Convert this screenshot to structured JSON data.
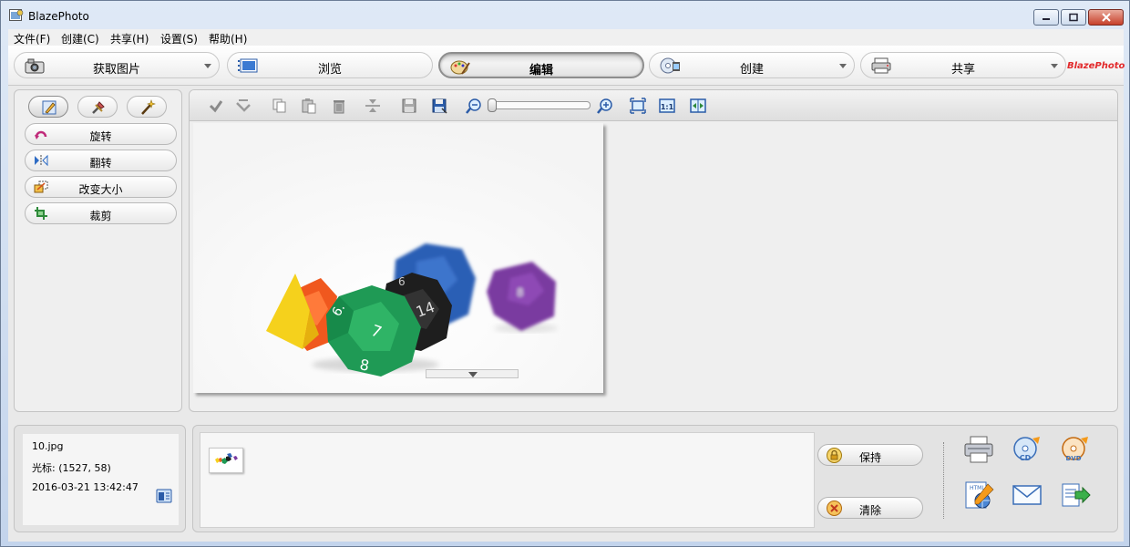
{
  "window": {
    "title": "BlazePhoto"
  },
  "menu": [
    "文件(F)",
    "创建(C)",
    "共享(H)",
    "设置(S)",
    "帮助(H)"
  ],
  "modebar": {
    "buttons": [
      {
        "label": "获取图片",
        "icon": "camera-icon",
        "dropdown": true
      },
      {
        "label": "浏览",
        "icon": "browse-icon",
        "dropdown": false
      },
      {
        "label": "编辑",
        "icon": "palette-icon",
        "dropdown": false,
        "active": true
      },
      {
        "label": "创建",
        "icon": "cd-film-icon",
        "dropdown": true
      },
      {
        "label": "共享",
        "icon": "printer-icon",
        "dropdown": true
      }
    ],
    "brand": "BlazePhoto"
  },
  "left_panel": {
    "tabs": [
      "pencil-icon",
      "tools-icon",
      "magic-wand-icon"
    ],
    "tools": [
      {
        "label": "旋转",
        "icon": "rotate-icon"
      },
      {
        "label": "翻转",
        "icon": "flip-icon"
      },
      {
        "label": "改变大小",
        "icon": "resize-icon"
      },
      {
        "label": "裁剪",
        "icon": "crop-icon"
      }
    ]
  },
  "edit_toolbar": {
    "tools": [
      "undo-icon",
      "redo-icon",
      "copy-icon",
      "paste-icon",
      "delete-icon",
      "split-icon",
      "save-icon",
      "save-as-icon",
      "zoom-out-icon",
      "zoom-in-icon",
      "fit-window-icon",
      "actual-size-icon",
      "fit-width-icon"
    ],
    "zoom_level": 0
  },
  "info": {
    "filename": "10.jpg",
    "cursor": "光标: (1527, 58)",
    "datetime": "2016-03-21 13:42:47"
  },
  "tray": {
    "keep_label": "保持",
    "clear_label": "清除",
    "share_icons": [
      "print-icon",
      "burn-cd-icon",
      "burn-dvd-icon",
      "html-gallery-icon",
      "email-icon",
      "export-icon"
    ]
  },
  "colors": {
    "accent_red": "#c7402a",
    "chrome_blue": "#c3d4ec"
  }
}
